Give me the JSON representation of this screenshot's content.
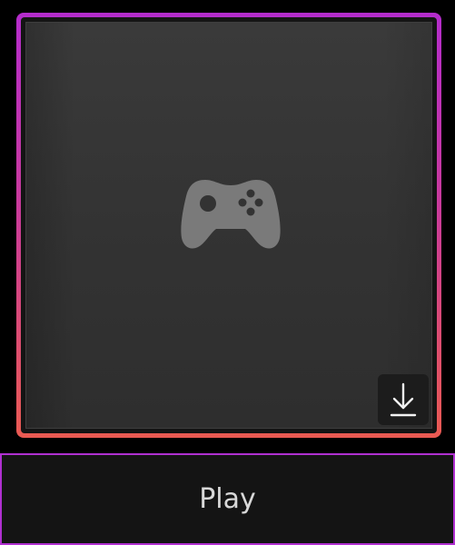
{
  "tile": {
    "icon": "game-controller-icon",
    "download_icon": "download-icon"
  },
  "play_button": {
    "label": "Play"
  },
  "colors": {
    "border_gradient_top": "#b42ccc",
    "border_gradient_bottom": "#ea5a52",
    "play_border": "#b030d0",
    "tile_bg": "#353535",
    "icon_fill": "#7a7a7a"
  }
}
